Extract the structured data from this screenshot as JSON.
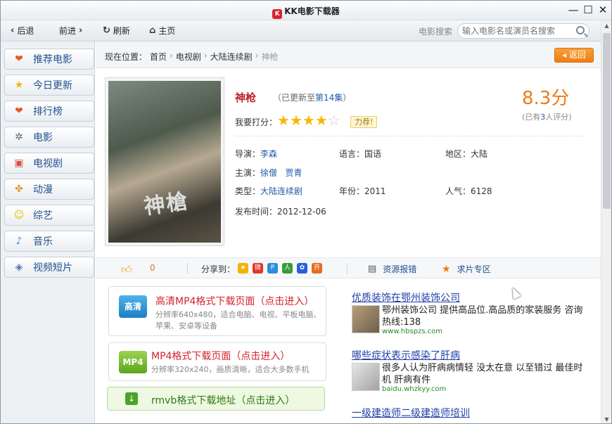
{
  "window": {
    "title": "KK电影下载器",
    "app_icon": "kk-app-icon"
  },
  "toolbar": {
    "back": "后退",
    "forward": "前进",
    "refresh": "刷新",
    "home": "主页",
    "search_label": "电影搜索",
    "search_placeholder": "输入电影名或演员名搜索"
  },
  "sidebar": {
    "items": [
      {
        "label": "推荐电影",
        "icon": "heart-icon",
        "color": "#e8572c"
      },
      {
        "label": "今日更新",
        "icon": "star-icon",
        "color": "#f2b400"
      },
      {
        "label": "排行榜",
        "icon": "heart-icon",
        "color": "#e8572c"
      },
      {
        "label": "电影",
        "icon": "film-reel-icon",
        "color": "#666666"
      },
      {
        "label": "电视剧",
        "icon": "tv-icon",
        "color": "#d94f3d"
      },
      {
        "label": "动漫",
        "icon": "gingerbread-icon",
        "color": "#e39a3b"
      },
      {
        "label": "综艺",
        "icon": "smile-icon",
        "color": "#e3c300"
      },
      {
        "label": "音乐",
        "icon": "music-icon",
        "color": "#3a8bd8"
      },
      {
        "label": "视频短片",
        "icon": "video-clip-icon",
        "color": "#5a6fb5"
      }
    ]
  },
  "breadcrumb": {
    "prefix": "现在位置：",
    "items": [
      "首页",
      "电视剧",
      "大陆连续剧"
    ],
    "current": "神枪",
    "back_label": "返回"
  },
  "movie": {
    "title": "神枪",
    "update_prefix": "（已更新至",
    "update_episode": "第14集",
    "update_suffix": "）",
    "score": "8.3分",
    "score_note_prefix": "(已有",
    "score_count": "3",
    "score_note_suffix": "人评分)",
    "rate_label": "我要打分：",
    "stars": 4,
    "stars_max": 5,
    "tip": "力荐!",
    "poster_title": "神槍",
    "director_label": "导演：",
    "director": "李森",
    "language_label": "语言：",
    "language": "国语",
    "region_label": "地区：",
    "region": "大陆",
    "cast_label": "主演：",
    "cast": [
      "徐僧",
      "贾青"
    ],
    "genre_label": "类型：",
    "genre": "大陆连续剧",
    "year_label": "年份：",
    "year": "2011",
    "popularity_label": "人气：",
    "popularity": "6128",
    "release_label": "发布时间：",
    "release": "2012-12-06"
  },
  "actions": {
    "likes": "0",
    "share_label": "分享到：",
    "report": "资源报错",
    "special": "求片专区",
    "share_icons": [
      {
        "name": "qzone-icon",
        "color": "#f2b400",
        "glyph": "★"
      },
      {
        "name": "weibo-icon",
        "color": "#e2352c",
        "glyph": "微"
      },
      {
        "name": "tencent-weibo-icon",
        "color": "#2a8fd8",
        "glyph": "P"
      },
      {
        "name": "renren-icon",
        "color": "#3a9a3a",
        "glyph": "人"
      },
      {
        "name": "baidu-icon",
        "color": "#2b5fd9",
        "glyph": "✿"
      },
      {
        "name": "kaixin-icon",
        "color": "#e86a1c",
        "glyph": "开"
      }
    ]
  },
  "downloads": [
    {
      "badge": "高清",
      "title": "高清MP4格式下载页面（点击进入）",
      "desc": "分辨率640x480，适合电脑、电视、平板电脑、苹果、安卓等设备"
    },
    {
      "badge": "MP4",
      "title": "MP4格式下载页面（点击进入）",
      "desc": "分辨率320x240，画质清晰，适合大多数手机"
    },
    {
      "badge": "↓",
      "title": "rmvb格式下载地址（点击进入）",
      "desc": ""
    }
  ],
  "ads": [
    {
      "title": "优质装饰在鄂州装饰公司",
      "text": "鄂州装饰公司 提供高品位.高品质的家装服务 咨询热线:138",
      "url": "www.hbspzs.com"
    },
    {
      "title": "哪些症状表示感染了肝病",
      "text": "很多人认为肝病病情轻 没太在意 以至错过 最佳时机 肝病有件",
      "url": "baidu.whzkyy.com"
    },
    {
      "title": "一级建造师二级建造师培训",
      "text": "",
      "url": ""
    }
  ]
}
